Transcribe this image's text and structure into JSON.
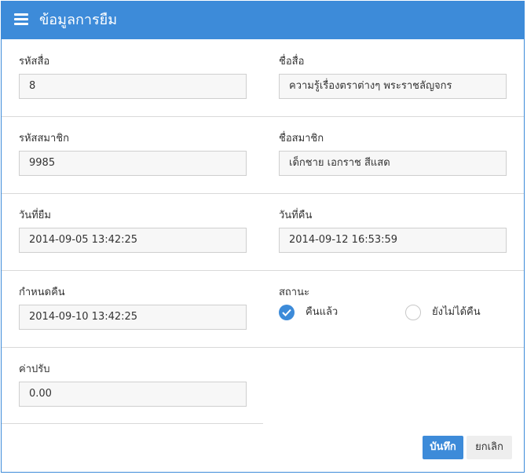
{
  "header": {
    "title": "ข้อมูลการยืม"
  },
  "fields": {
    "media_id": {
      "label": "รหัสสื่อ",
      "value": "8"
    },
    "media_name": {
      "label": "ชื่อสื่อ",
      "value": "ความรู้เรื่องตราต่างๆ พระราชลัญจกร"
    },
    "member_id": {
      "label": "รหัสสมาชิก",
      "value": "9985"
    },
    "member_name": {
      "label": "ชื่อสมาชิก",
      "value": "เด็กชาย เอกราช สีแสด"
    },
    "borrow_date": {
      "label": "วันที่ยืม",
      "value": "2014-09-05 13:42:25"
    },
    "return_date": {
      "label": "วันที่คืน",
      "value": "2014-09-12 16:53:59"
    },
    "due_date": {
      "label": "กำหนดคืน",
      "value": "2014-09-10 13:42:25"
    },
    "fine": {
      "label": "ค่าปรับ",
      "value": "0.00"
    }
  },
  "status": {
    "label": "สถานะ",
    "options": [
      {
        "label": "คืนแล้ว",
        "selected": true
      },
      {
        "label": "ยังไม่ได้คืน",
        "selected": false
      }
    ]
  },
  "actions": {
    "save": "บันทึก",
    "cancel": "ยกเลิก"
  },
  "colors": {
    "accent": "#3d8bd9"
  }
}
